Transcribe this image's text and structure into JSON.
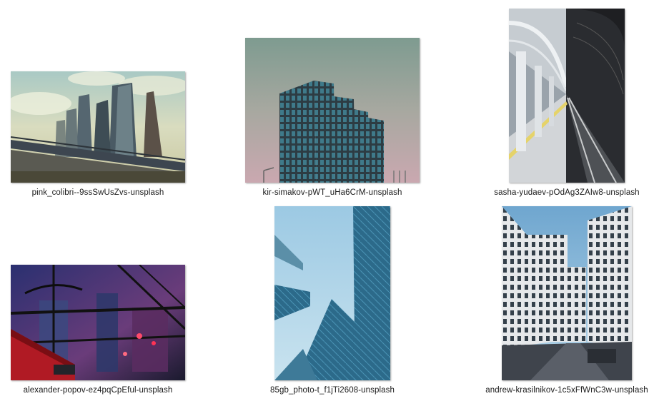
{
  "files": [
    {
      "name": "pink_colibri--9ssSwUsZvs-unsplash",
      "icon": "image-thumbnail-icon"
    },
    {
      "name": "kir-simakov-pWT_uHa6CrM-unsplash",
      "icon": "image-thumbnail-icon"
    },
    {
      "name": "sasha-yudaev-pOdAg3ZAIw8-unsplash",
      "icon": "image-thumbnail-icon"
    },
    {
      "name": "alexander-popov-ez4pqCpEful-unsplash",
      "icon": "image-thumbnail-icon"
    },
    {
      "name": "85gb_photo-t_f1jTi2608-unsplash",
      "icon": "image-thumbnail-icon"
    },
    {
      "name": "andrew-krasilnikov-1c5xFfWnC3w-unsplash",
      "icon": "image-thumbnail-icon"
    }
  ]
}
